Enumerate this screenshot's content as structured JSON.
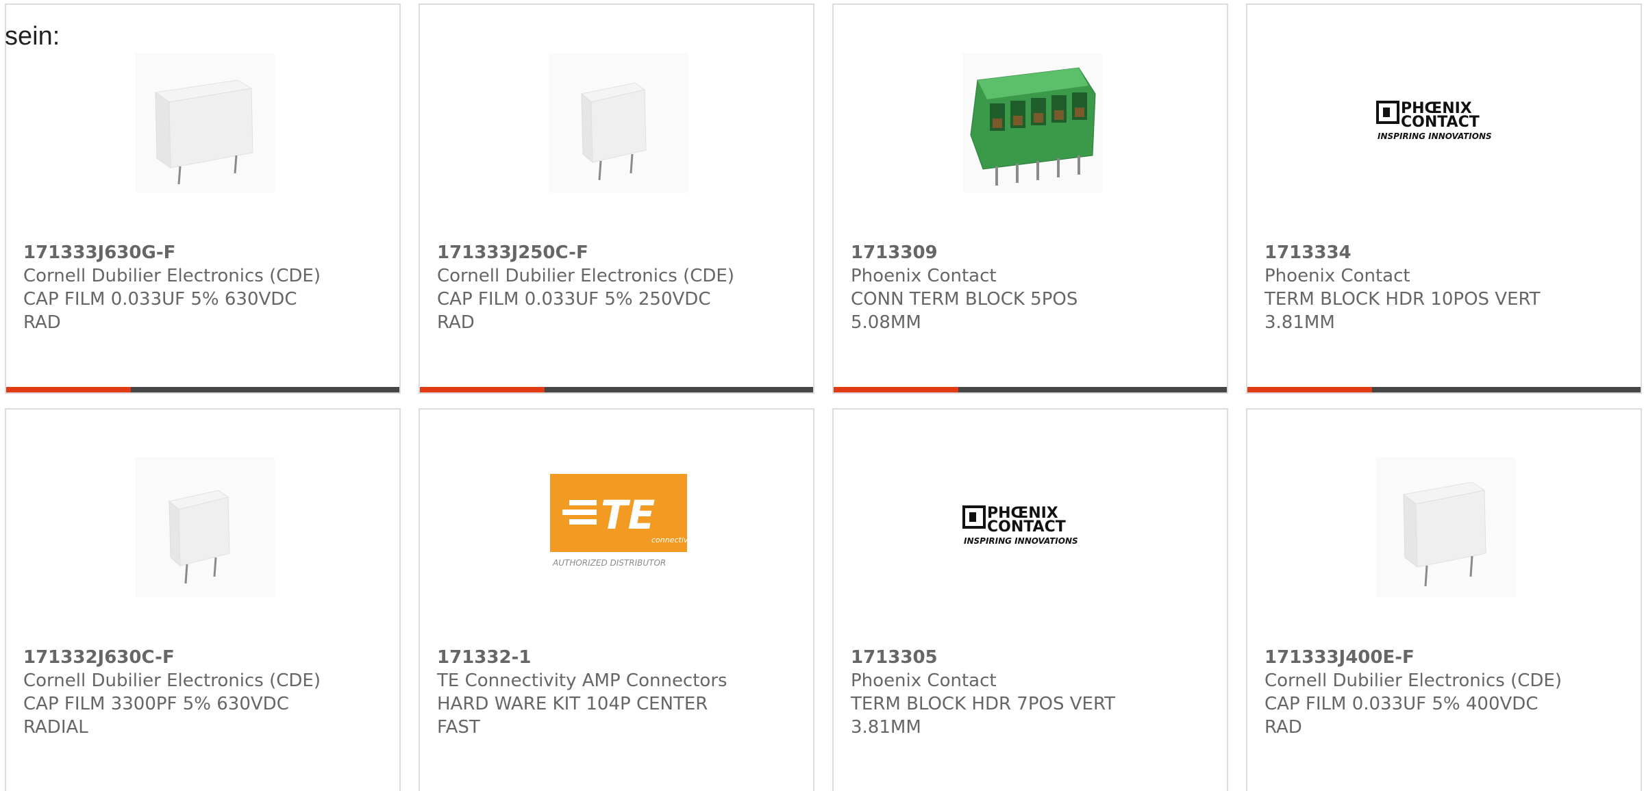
{
  "heading": "sein:",
  "products": [
    {
      "part_number": "171333J630G-F",
      "manufacturer": "Cornell Dubilier Electronics (CDE)",
      "desc_line1": "CAP FILM 0.033UF 5% 630VDC",
      "desc_line2": "RAD",
      "image": "film-capacitor"
    },
    {
      "part_number": "171333J250C-F",
      "manufacturer": "Cornell Dubilier Electronics (CDE)",
      "desc_line1": "CAP FILM 0.033UF 5% 250VDC",
      "desc_line2": "RAD",
      "image": "film-capacitor-small"
    },
    {
      "part_number": "1713309",
      "manufacturer": "Phoenix Contact",
      "desc_line1": "CONN TERM BLOCK 5POS",
      "desc_line2": "5.08MM",
      "image": "green-terminal-block"
    },
    {
      "part_number": "1713334",
      "manufacturer": "Phoenix Contact",
      "desc_line1": "TERM BLOCK HDR 10POS VERT",
      "desc_line2": "3.81MM",
      "image": "phoenix-contact-logo"
    },
    {
      "part_number": "171332J630C-F",
      "manufacturer": "Cornell Dubilier Electronics (CDE)",
      "desc_line1": "CAP FILM 3300PF 5% 630VDC",
      "desc_line2": "RADIAL",
      "image": "film-capacitor-small"
    },
    {
      "part_number": "171332-1",
      "manufacturer": "TE Connectivity AMP Connectors",
      "desc_line1": "HARD WARE KIT 104P CENTER",
      "desc_line2": "FAST",
      "image": "te-connectivity-logo"
    },
    {
      "part_number": "1713305",
      "manufacturer": "Phoenix Contact",
      "desc_line1": "TERM BLOCK HDR 7POS VERT",
      "desc_line2": "3.81MM",
      "image": "phoenix-contact-logo"
    },
    {
      "part_number": "171333J400E-F",
      "manufacturer": "Cornell Dubilier Electronics (CDE)",
      "desc_line1": "CAP FILM 0.033UF 5% 400VDC",
      "desc_line2": "RAD",
      "image": "film-capacitor"
    }
  ],
  "logos": {
    "phoenix_line1": "PHŒNIX",
    "phoenix_line2": "CONTACT",
    "phoenix_tagline": "INSPIRING INNOVATIONS",
    "te_mark": "TE",
    "te_sub": "connectivity",
    "te_authorized": "AUTHORIZED DISTRIBUTOR"
  },
  "colors": {
    "accent": "#e23a12",
    "bar": "#474747",
    "text": "#666666",
    "border": "#dcdcdc",
    "te_orange": "#f39a22",
    "terminal_green": "#3a9a4a"
  }
}
